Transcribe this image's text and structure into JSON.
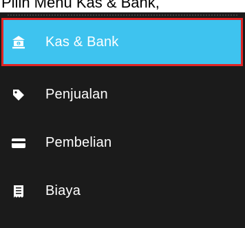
{
  "caption": "Pilih Menu Kas & Bank,",
  "menu": {
    "items": [
      {
        "label": "Kas & Bank",
        "icon": "bank-icon",
        "active": true
      },
      {
        "label": "Penjualan",
        "icon": "price-tag-icon",
        "active": false
      },
      {
        "label": "Pembelian",
        "icon": "credit-card-icon",
        "active": false
      },
      {
        "label": "Biaya",
        "icon": "receipt-icon",
        "active": false
      }
    ]
  },
  "colors": {
    "sidebar_bg": "#1b1b1b",
    "active_bg": "#3ec3ef",
    "highlight_border": "#e02424",
    "text": "#ffffff"
  }
}
